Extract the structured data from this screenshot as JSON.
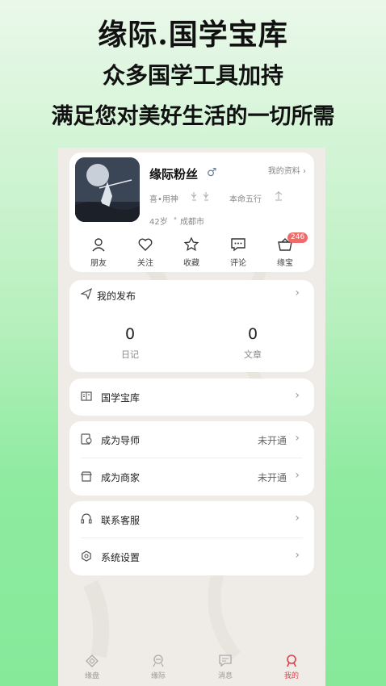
{
  "promo": {
    "line1": "缘际.国学宝库",
    "line2": "众多国学工具加持",
    "line3": "满足您对美好生活的一切所需"
  },
  "profile": {
    "username": "缘际粉丝",
    "gender_symbol": "♂",
    "my_data_label": "我的资料 ›",
    "like_god_label": "喜•用神",
    "fate_element_label": "本命五行",
    "age": "42岁",
    "city": "成都市"
  },
  "actions": [
    {
      "label": "朋友",
      "icon": "friends-icon"
    },
    {
      "label": "关注",
      "icon": "heart-icon"
    },
    {
      "label": "收藏",
      "icon": "star-icon"
    },
    {
      "label": "评论",
      "icon": "comment-icon"
    },
    {
      "label": "缘宝",
      "icon": "basket-icon",
      "badge": "246"
    }
  ],
  "publish": {
    "title": "我的发布",
    "stats": [
      {
        "value": "0",
        "label": "日记"
      },
      {
        "value": "0",
        "label": "文章"
      }
    ]
  },
  "menu": {
    "library": "国学宝库",
    "mentor": "成为导师",
    "mentor_status": "未开通",
    "merchant": "成为商家",
    "merchant_status": "未开通",
    "support": "联系客服",
    "settings": "系统设置"
  },
  "tabs": [
    {
      "label": "缘盘",
      "icon": "chart-icon"
    },
    {
      "label": "缘际",
      "icon": "fate-icon"
    },
    {
      "label": "消息",
      "icon": "message-icon"
    },
    {
      "label": "我的",
      "icon": "profile-icon",
      "active": true
    }
  ],
  "colors": {
    "accent": "#d9414f",
    "badge": "#ee6b6b",
    "background_top": "#eaf8ea",
    "background_bottom": "#86e99a"
  }
}
